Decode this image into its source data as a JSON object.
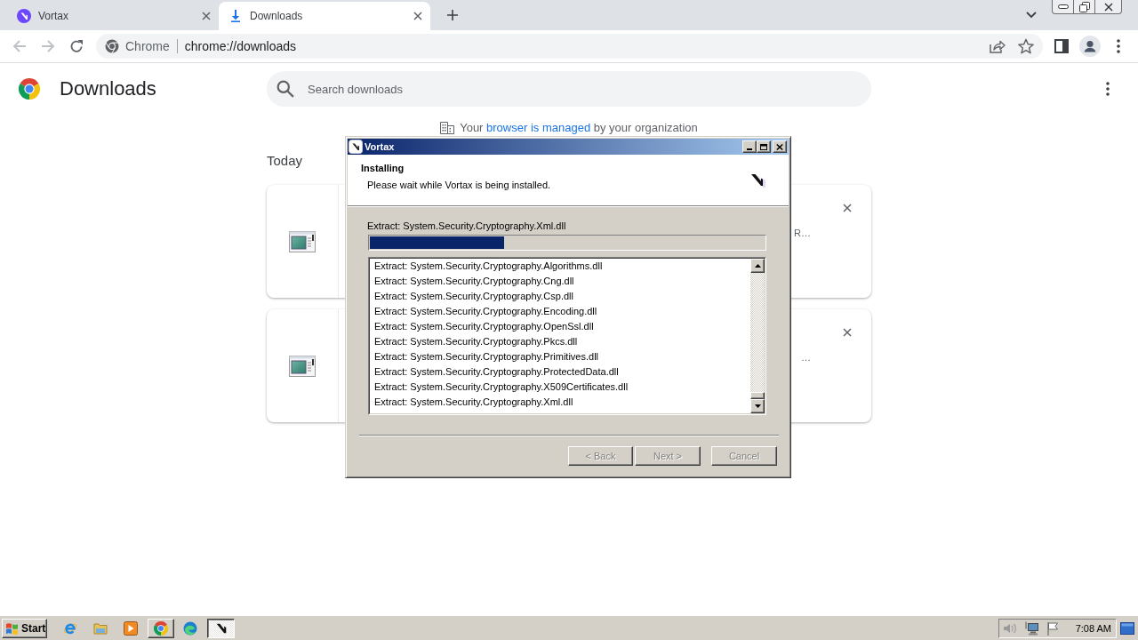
{
  "browser": {
    "tabs": [
      {
        "title": "Vortax",
        "selected": false
      },
      {
        "title": "Downloads",
        "selected": true
      }
    ],
    "toolbar": {
      "back": {
        "disabled": true
      },
      "forward": {
        "disabled": true
      }
    },
    "omnibox": {
      "site_label": "Chrome",
      "url": "chrome://downloads"
    }
  },
  "page": {
    "title": "Downloads",
    "search": {
      "placeholder": "Search downloads"
    },
    "managed_notice": {
      "before": "Your ",
      "link": "browser is managed",
      "after": " by your organization"
    },
    "section_label": "Today",
    "downloads": [
      {
        "trailing_text": "R…"
      },
      {
        "trailing_text": "…"
      }
    ]
  },
  "installer": {
    "title": "Vortax",
    "heading": "Installing",
    "subheading": "Please wait while Vortax is being installed.",
    "status": "Extract: System.Security.Cryptography.Xml.dll",
    "progress": {
      "level": 0.34
    },
    "log": [
      "Extract: System.Security.Cryptography.Algorithms.dll",
      "Extract: System.Security.Cryptography.Cng.dll",
      "Extract: System.Security.Cryptography.Csp.dll",
      "Extract: System.Security.Cryptography.Encoding.dll",
      "Extract: System.Security.Cryptography.OpenSsl.dll",
      "Extract: System.Security.Cryptography.Pkcs.dll",
      "Extract: System.Security.Cryptography.Primitives.dll",
      "Extract: System.Security.Cryptography.ProtectedData.dll",
      "Extract: System.Security.Cryptography.X509Certificates.dll",
      "Extract: System.Security.Cryptography.Xml.dll"
    ],
    "buttons": [
      {
        "label": "< Back",
        "disabled": true
      },
      {
        "label": "Next >",
        "disabled": true
      },
      {
        "label": "Cancel",
        "disabled": true
      }
    ]
  },
  "taskbar": {
    "start_label": "Start",
    "window_buttons": [
      {
        "selected": false
      },
      {
        "selected": true
      }
    ],
    "clock": "7:08 AM"
  }
}
